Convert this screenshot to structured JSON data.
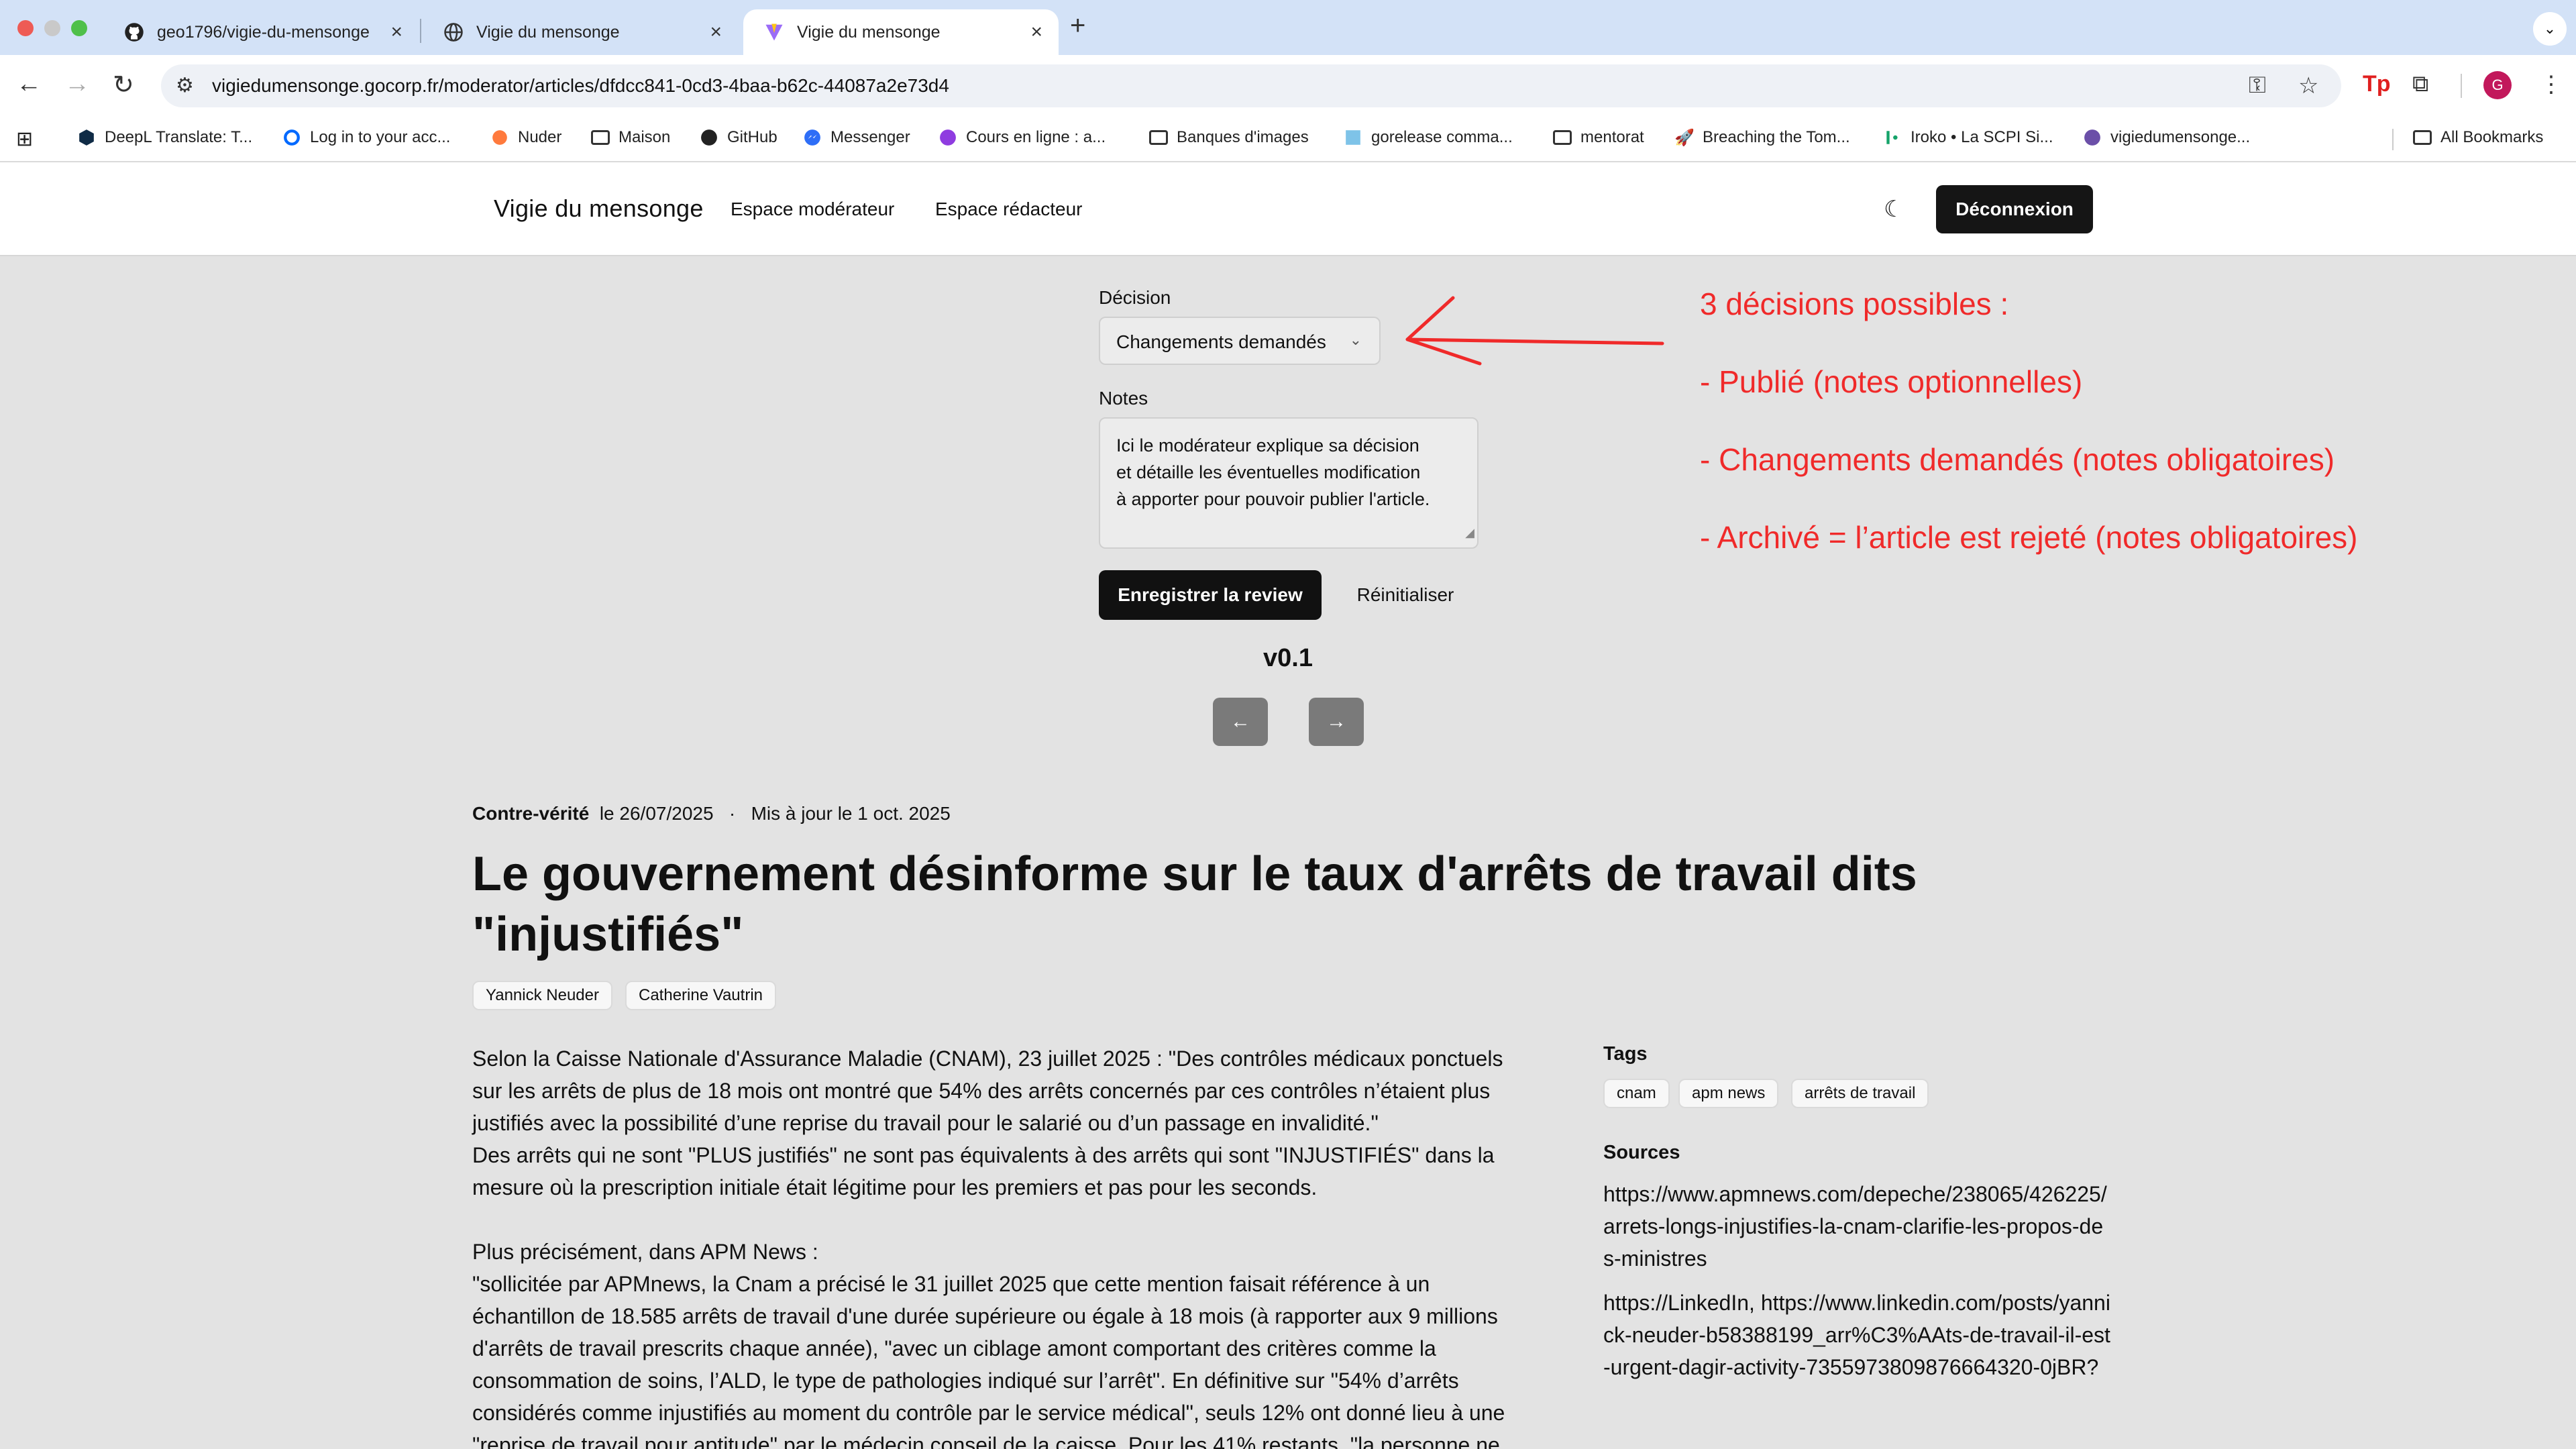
{
  "browser": {
    "tabs": [
      {
        "title": "geo1796/vigie-du-mensonge",
        "icon": "github-icon"
      },
      {
        "title": "Vigie du mensonge",
        "icon": "globe-icon"
      },
      {
        "title": "Vigie du mensonge",
        "icon": "vite-icon",
        "active": true
      }
    ],
    "new_tab_symbol": "+",
    "url": "vigiedumensonge.gocorp.fr/moderator/articles/dfdcc841-0cd3-4baa-b62c-44087a2e73d4",
    "bookmarks": [
      {
        "label": "DeepL Translate: T...",
        "icon": "deepl-icon"
      },
      {
        "label": "Log in to your acc...",
        "icon": "digitalocean-icon"
      },
      {
        "label": "Nuder",
        "icon": "nuder-icon"
      },
      {
        "label": "Maison",
        "icon": "folder-icon"
      },
      {
        "label": "GitHub",
        "icon": "github-icon"
      },
      {
        "label": "Messenger",
        "icon": "messenger-icon"
      },
      {
        "label": "Cours en ligne  : a...",
        "icon": "udemy-icon"
      },
      {
        "label": "Banques d'images",
        "icon": "folder-icon"
      },
      {
        "label": "gorelease comma...",
        "icon": "gorelease-icon"
      },
      {
        "label": "mentorat",
        "icon": "folder-icon"
      },
      {
        "label": "Breaching the Tom...",
        "icon": "rocket-icon"
      },
      {
        "label": "Iroko • La SCPI Si...",
        "icon": "iroko-icon"
      },
      {
        "label": "vigiedumensonge...",
        "icon": "site-icon"
      }
    ],
    "all_bookmarks": "All Bookmarks",
    "profile_initial": "G"
  },
  "site": {
    "brand": "Vigie du mensonge",
    "nav": [
      "Espace modérateur",
      "Espace rédacteur"
    ],
    "logout_label": "Déconnexion"
  },
  "review": {
    "decision_label": "Décision",
    "decision_value": "Changements demandés",
    "notes_label": "Notes",
    "notes_value": "Ici le modérateur explique sa décision\net détaille les éventuelles modification\nà apporter pour pouvoir publier l'article.",
    "save_label": "Enregistrer la review",
    "reset_label": "Réinitialiser",
    "version": "v0.1"
  },
  "annotation": {
    "lines": [
      "3 décisions possibles :",
      "- Publié (notes optionnelles)",
      "- Changements demandés (notes obligatoires)",
      "- Archivé = l’article est rejeté (notes obligatoires)"
    ],
    "color": "#f02a2a"
  },
  "article": {
    "category": "Contre-vérité",
    "date": "le 26/07/2025",
    "separator": "·",
    "updated": "Mis à jour le 1 oct. 2025",
    "title": "Le gouvernement désinforme sur le taux d'arrêts de travail dits \"injustifiés\"",
    "politicians": [
      "Yannick Neuder",
      "Catherine Vautrin"
    ],
    "body": [
      "Selon la Caisse Nationale d'Assurance Maladie (CNAM), 23 juillet 2025 : \"Des contrôles médicaux ponctuels sur les arrêts de plus de 18 mois ont montré que 54% des arrêts concernés par ces contrôles n’étaient plus justifiés avec la possibilité d’une reprise du travail pour le salarié ou d’un passage en invalidité.\"",
      "Des arrêts qui ne sont \"PLUS justifiés\" ne sont pas équivalents à des arrêts qui sont \"INJUSTIFIÉS\" dans la mesure où la prescription initiale était légitime pour les premiers et pas pour les seconds.",
      "",
      "Plus précisément, dans APM News :",
      "\"sollicitée par APMnews, la Cnam a précisé le 31 juillet 2025 que cette mention faisait référence à un échantillon de 18.585 arrêts de travail d'une durée supérieure ou égale à 18 mois (à rapporter aux 9 millions d'arrêts de travail prescrits chaque année), \"avec un ciblage amont comportant des critères comme la consommation de soins, l’ALD, le type de pathologies indiqué sur l’arrêt\". En définitive sur \"54% d’arrêts considérés comme injustifiés au moment du contrôle par le service médical\", seuls 12% ont donné lieu à une \"reprise de travail pour aptitude\" par le médecin conseil de la caisse. Pour les 41% restants, \"la personne ne"
    ],
    "tags_label": "Tags",
    "tags": [
      "cnam",
      "apm news",
      "arrêts de travail"
    ],
    "sources_label": "Sources",
    "sources": [
      "https://www.apmnews.com/depeche/238065/426225/arrets-longs-injustifies-la-cnam-clarifie-les-propos-des-ministres",
      "https://LinkedIn, https://www.linkedin.com/posts/yannick-neuder-b58388199_arr%C3%AAts-de-travail-il-est-urgent-dagir-activity-7355973809876664320-0jBR?"
    ]
  }
}
